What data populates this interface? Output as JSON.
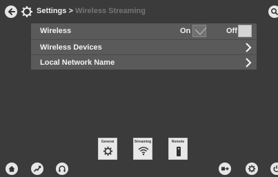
{
  "header": {
    "breadcrumb_parent": "Settings >",
    "breadcrumb_current": "Wireless Streaming",
    "back_icon": "back-arrow-icon",
    "settings_icon": "gear-icon",
    "search_icon": "search-icon"
  },
  "settings_list": {
    "wireless": {
      "label": "Wireless",
      "on_label": "On",
      "off_label": "Off",
      "selected": "On"
    },
    "wireless_devices": {
      "label": "Wireless Devices"
    },
    "local_network_name": {
      "label": "Local Network Name"
    }
  },
  "tabs": [
    {
      "label": "General",
      "icon": "gear-icon"
    },
    {
      "label": "Streaming",
      "icon": "wifi-icon",
      "active": true
    },
    {
      "label": "Remote",
      "icon": "remote-icon"
    }
  ],
  "bottom_bar": {
    "left": [
      "home-icon",
      "performance-graph-icon",
      "headphones-icon"
    ],
    "right": [
      "source-input-icon",
      "gear-icon",
      "power-icon"
    ]
  },
  "colors": {
    "background": "#3b3b3b",
    "panel": "#5a5a5a",
    "text": "#f2f2f2",
    "muted_text": "#767676",
    "button": "#e6e6e6"
  }
}
